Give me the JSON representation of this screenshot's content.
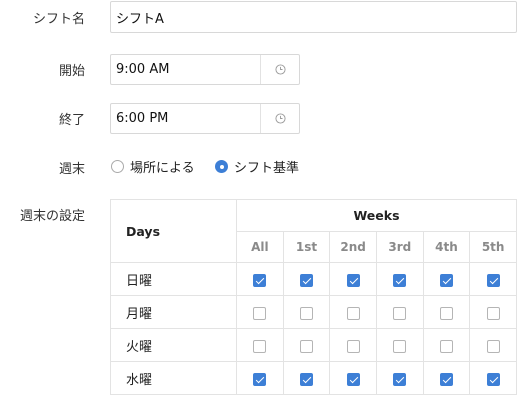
{
  "form": {
    "shift_name_label": "シフト名",
    "shift_name_value": "シフトA",
    "start_label": "開始",
    "start_value": "9:00 AM",
    "end_label": "終了",
    "end_value": "6:00 PM",
    "weekend_label": "週末",
    "weekend_options": [
      {
        "label": "場所による",
        "selected": false
      },
      {
        "label": "シフト基準",
        "selected": true
      }
    ],
    "weekend_settings_label": "週末の設定"
  },
  "grid": {
    "days_header": "Days",
    "weeks_header": "Weeks",
    "week_columns": [
      "All",
      "1st",
      "2nd",
      "3rd",
      "4th",
      "5th"
    ],
    "rows": [
      {
        "day": "日曜",
        "checks": [
          true,
          true,
          true,
          true,
          true,
          true
        ]
      },
      {
        "day": "月曜",
        "checks": [
          false,
          false,
          false,
          false,
          false,
          false
        ]
      },
      {
        "day": "火曜",
        "checks": [
          false,
          false,
          false,
          false,
          false,
          false
        ]
      },
      {
        "day": "水曜",
        "checks": [
          true,
          true,
          true,
          true,
          true,
          true
        ]
      }
    ]
  },
  "colors": {
    "accent": "#3d7fd6",
    "border": "#d8d8d8"
  },
  "icons": {
    "time": "clock-icon"
  }
}
